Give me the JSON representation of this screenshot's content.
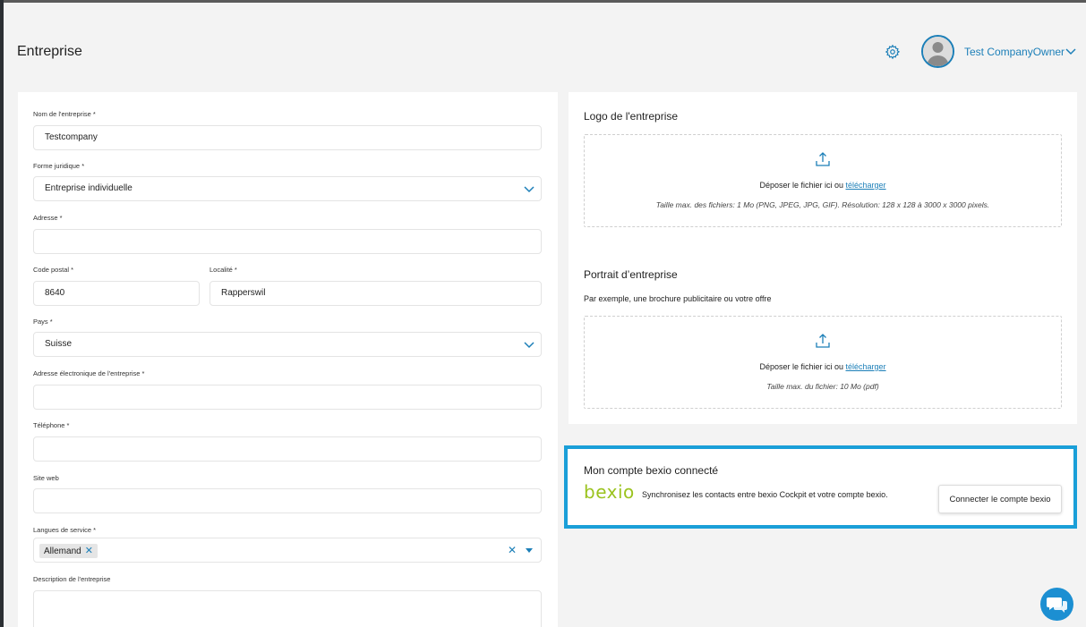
{
  "header": {
    "title": "Entreprise",
    "settings_icon": "gear-icon",
    "user_name": "Test CompanyOwner",
    "user_menu_icon": "chevron-down-icon"
  },
  "form": {
    "company_name": {
      "label": "Nom de l'entreprise *",
      "value": "Testcompany"
    },
    "legal_form": {
      "label": "Forme juridique *",
      "value": "Entreprise individuelle"
    },
    "address": {
      "label": "Adresse *",
      "value": ""
    },
    "postal_code": {
      "label": "Code postal *",
      "value": "8640"
    },
    "locality": {
      "label": "Localité *",
      "value": "Rapperswil"
    },
    "country": {
      "label": "Pays *",
      "value": "Suisse"
    },
    "email": {
      "label": "Adresse électronique de l'entreprise *",
      "value": ""
    },
    "phone": {
      "label": "Téléphone *",
      "value": ""
    },
    "website": {
      "label": "Site web",
      "value": ""
    },
    "languages": {
      "label": "Langues de service *",
      "selected": [
        "Allemand"
      ]
    },
    "description": {
      "label": "Description de l'entreprise",
      "value": ""
    }
  },
  "logo": {
    "title": "Logo de l'entreprise",
    "drop_text": "Déposer le fichier ici ou",
    "link": "télécharger",
    "hint": "Taille max. des fichiers: 1 Mo (PNG, JPEG, JPG, GIF). Résolution: 128 x 128 à 3000 x 3000 pixels."
  },
  "portrait": {
    "title": "Portrait d’entreprise",
    "subtitle": "Par exemple, une brochure publicitaire ou votre offre",
    "drop_text": "Déposer le fichier ici ou",
    "link": "télécharger",
    "hint": "Taille max. du fichier: 10 Mo (pdf)"
  },
  "bexio": {
    "title": "Mon compte bexio connecté",
    "logo_text": "bexio",
    "description": "Synchronisez les contacts entre bexio Cockpit et votre compte bexio.",
    "button": "Connecter le compte bexio",
    "highlight_color": "#1a9fd8"
  },
  "colors": {
    "accent": "#1c7fb8",
    "bexio_green": "#9bc31f"
  }
}
